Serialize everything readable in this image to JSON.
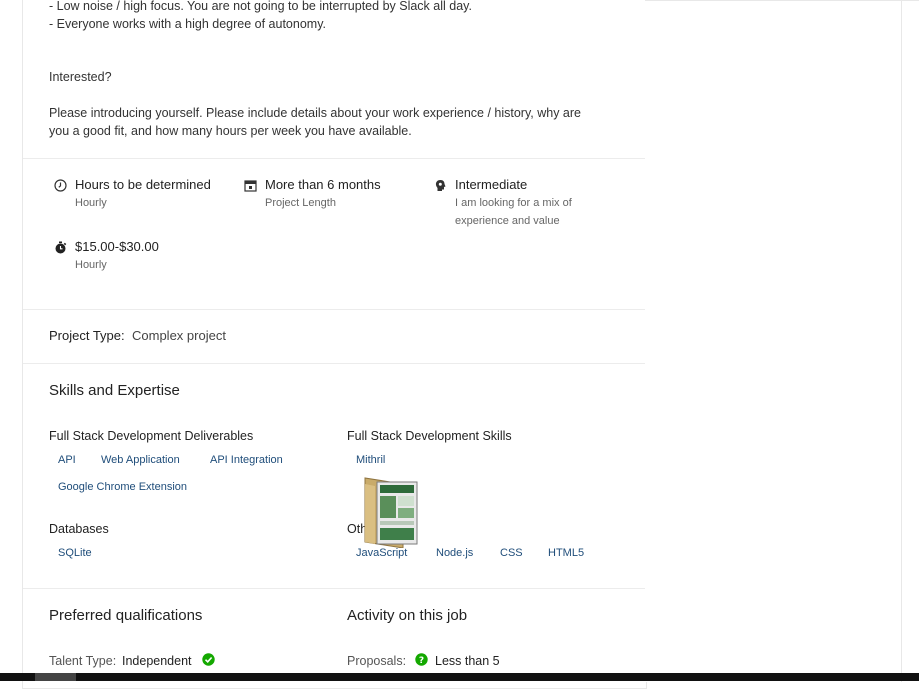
{
  "description": {
    "line1": "- Low noise / high focus. You are not going to be interrupted by Slack all day.",
    "line2": "- Everyone works with a high degree of autonomy.",
    "interested": "Interested?",
    "para1": "Please introducing yourself. Please include details about your work experience / history, why are",
    "para2": "you a good fit, and how many hours per week you have available."
  },
  "features": {
    "hours": {
      "title": "Hours to be determined",
      "sub": "Hourly",
      "icon": "clock-icon"
    },
    "length": {
      "title": "More than 6 months",
      "sub": "Project Length",
      "icon": "calendar-icon"
    },
    "level": {
      "title": "Intermediate",
      "sub1": "I am looking for a mix of",
      "sub2": "experience and value",
      "icon": "brain-icon"
    },
    "rate": {
      "title": "$15.00-$30.00",
      "sub": "Hourly",
      "icon": "stopwatch-icon"
    }
  },
  "project_type": {
    "label": "Project Type:",
    "value": "Complex project"
  },
  "skills": {
    "heading": "Skills and Expertise",
    "deliverables": {
      "heading": "Full Stack Development Deliverables",
      "items": [
        "API",
        "Web Application",
        "API Integration",
        "Google Chrome Extension"
      ]
    },
    "fs_skills": {
      "heading": "Full Stack Development Skills",
      "items": [
        "Mithril"
      ]
    },
    "databases": {
      "heading": "Databases",
      "items": [
        "SQLite"
      ]
    },
    "other": {
      "heading": "Other",
      "items": [
        "JavaScript",
        "Node.js",
        "CSS",
        "HTML5"
      ]
    }
  },
  "qualifications": {
    "heading": "Preferred qualifications",
    "talent_label": "Talent Type:",
    "talent_value": "Independent"
  },
  "activity": {
    "heading": "Activity on this job",
    "proposals_label": "Proposals:",
    "proposals_value": "Less than 5"
  },
  "colors": {
    "accent_green": "#14a800",
    "skill_text": "#1f4d7a"
  }
}
